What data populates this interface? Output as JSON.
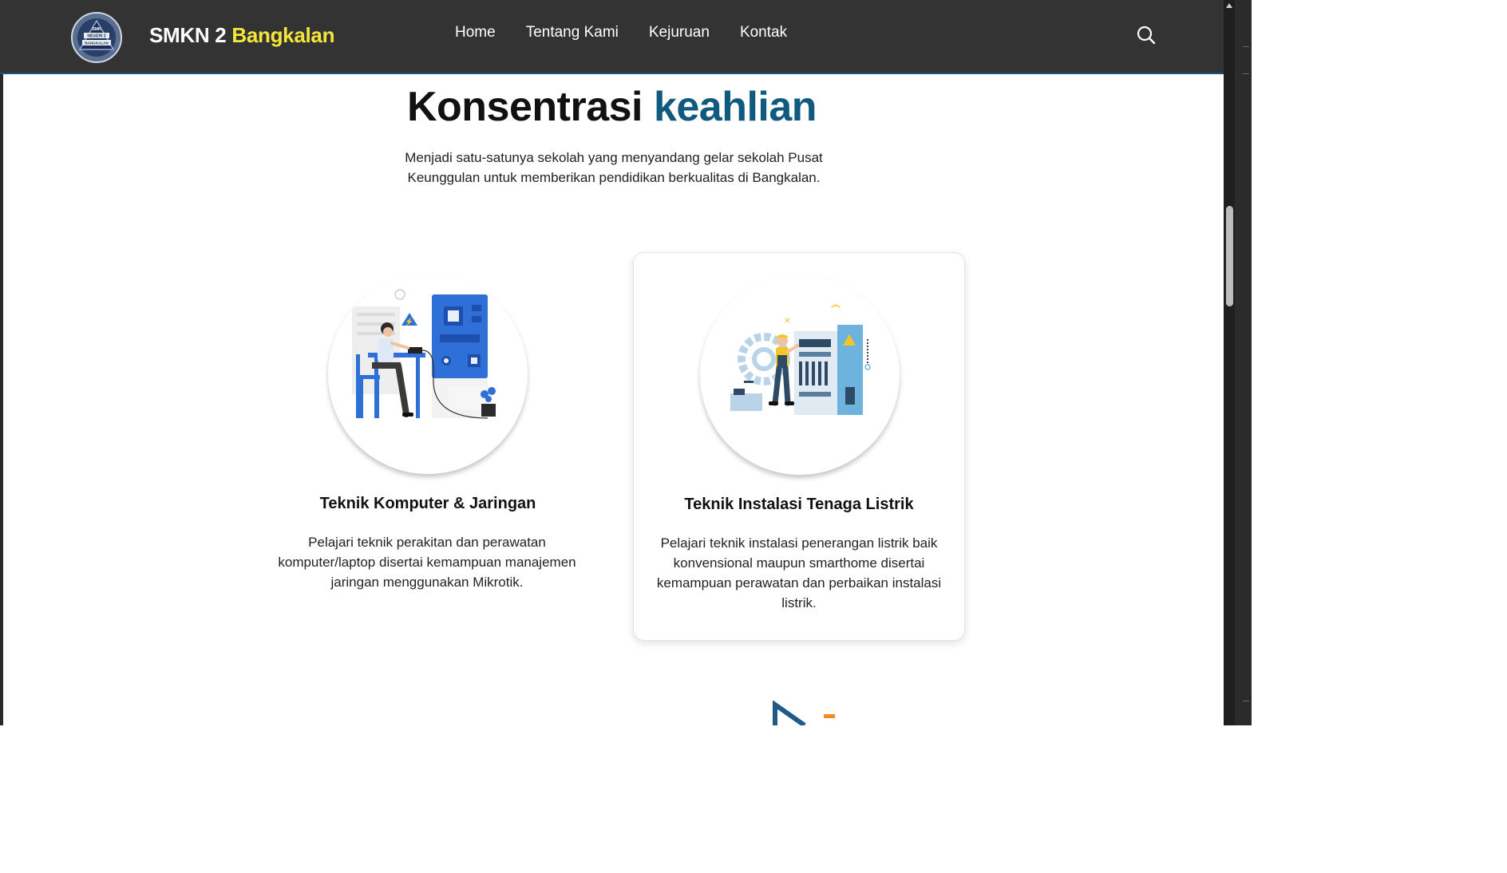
{
  "header": {
    "logo_text": "SMK NEGERI 2 BANGKALAN",
    "brand_primary": "SMKN 2",
    "brand_accent": "Bangkalan",
    "nav": [
      {
        "label": "Home"
      },
      {
        "label": "Tentang Kami"
      },
      {
        "label": "Kejuruan"
      },
      {
        "label": "Kontak"
      }
    ],
    "search_icon": "search-icon"
  },
  "section": {
    "heading_primary": "Konsentrasi",
    "heading_accent": "keahlian",
    "subtitle": "Menjadi satu-satunya sekolah yang menyandang gelar sekolah Pusat Keunggulan untuk memberikan pendidikan berkualitas di Bangkalan."
  },
  "cards": [
    {
      "title": "Teknik Komputer & Jaringan",
      "description": "Pelajari teknik perakitan dan perawatan komputer/laptop disertai kemampuan manajemen jaringan menggunakan Mikrotik.",
      "icon": "computer-technician-illustration"
    },
    {
      "title": "Teknik Instalasi Tenaga Listrik",
      "description": "Pelajari teknik instalasi penerangan listrik baik konvensional maupun smarthome disertai kemampuan perawatan dan perbaikan instalasi listrik.",
      "icon": "electrician-illustration"
    }
  ],
  "colors": {
    "header_bg": "#333333",
    "brand_accent": "#f5e63a",
    "heading_accent": "#0f5a7e",
    "illustration_blue": "#2f6fd8"
  }
}
